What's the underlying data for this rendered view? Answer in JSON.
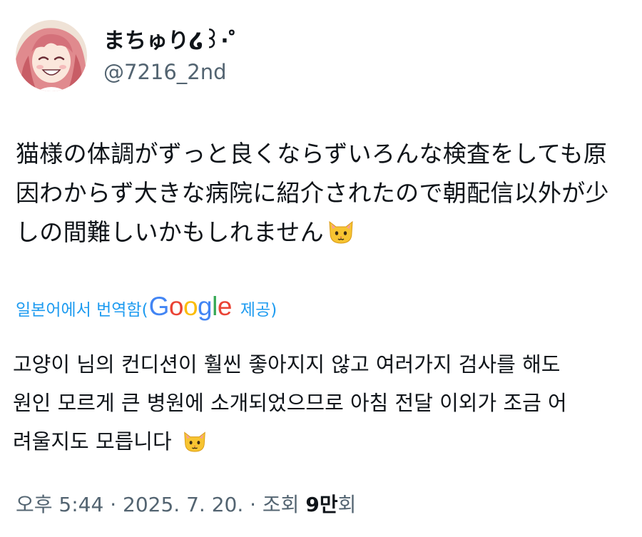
{
  "author": {
    "display_name": "まちゅり໒꒱·゜",
    "handle": "@7216_2nd",
    "avatar_icon": "avatar-image"
  },
  "tweet": {
    "lines": [
      "猫様の体調がずっと良くならずいろんな検査をしても原",
      "因わからず大きな病院に紹介されたので朝配信以外が少",
      "しの間難しいかもしれません"
    ],
    "emoji": "cat-face-emoji"
  },
  "translation": {
    "label": "일본어에서 번역함(",
    "provider": "Google",
    "suffix": "제공)",
    "lines": [
      "고양이 님의 컨디션이 훨씬 좋아지지 않고 여러가지 검사를 해도",
      "원인 모르게 큰 병원에 소개되었으므로 아침 전달 이외가 조금 어",
      "려울지도 모릅니다"
    ]
  },
  "meta": {
    "time": "오후 5:44",
    "sep1": " · ",
    "date": "2025. 7. 20.",
    "sep2": " · ",
    "views_label": "조회 ",
    "views_count": "9만",
    "views_suffix": "회"
  },
  "colors": {
    "link": "#1d9bf0",
    "secondary": "#536471",
    "text": "#0f1419"
  }
}
